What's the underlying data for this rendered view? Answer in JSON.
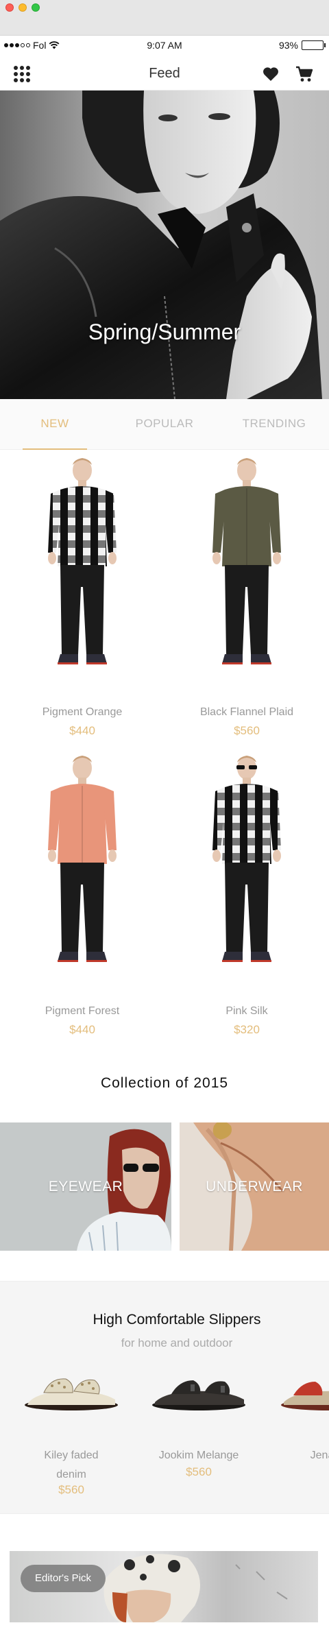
{
  "status_bar": {
    "carrier": "Fol",
    "time": "9:07 AM",
    "battery_percent": "93%",
    "battery_level": 0.93,
    "signal_bars": 3,
    "icons": [
      "signal-dots-icon",
      "wifi-icon",
      "battery-icon"
    ]
  },
  "nav": {
    "title": "Feed",
    "icons": [
      "grid-menu-icon",
      "heart-icon",
      "cart-icon"
    ]
  },
  "hero": {
    "title": "Spring/Summer"
  },
  "tabs": [
    {
      "label": "NEW",
      "active": true
    },
    {
      "label": "POPULAR",
      "active": false
    },
    {
      "label": "TRENDING",
      "active": false
    }
  ],
  "products": [
    {
      "name": "Pigment Orange",
      "price": "$440",
      "shirt": "black-white-check"
    },
    {
      "name": "Black Flannel Plaid",
      "price": "$560",
      "shirt": "olive"
    },
    {
      "name": "Pigment Forest",
      "price": "$440",
      "shirt": "salmon"
    },
    {
      "name": "Pink Silk",
      "price": "$320",
      "shirt": "black-white-check"
    }
  ],
  "collection": {
    "title": "Collection of 2015",
    "items": [
      {
        "label": "EYEWEAR"
      },
      {
        "label": "UNDERWEAR"
      }
    ]
  },
  "slippers": {
    "title": "High Comfortable Slippers",
    "subtitle": "for home and outdoor",
    "items": [
      {
        "name_line1": "Kiley faded",
        "name_line2": "denim",
        "price": "$560"
      },
      {
        "name_line1": "Jookim Melange",
        "name_line2": "",
        "price": "$560"
      },
      {
        "name_line1": "Jena",
        "name_line2": "",
        "price": "$"
      }
    ]
  },
  "editor": {
    "badge": "Editor's Pick"
  },
  "colors": {
    "accent": "#e3bd7c",
    "muted_text": "#999999",
    "tab_inactive": "#bbbbbb"
  }
}
